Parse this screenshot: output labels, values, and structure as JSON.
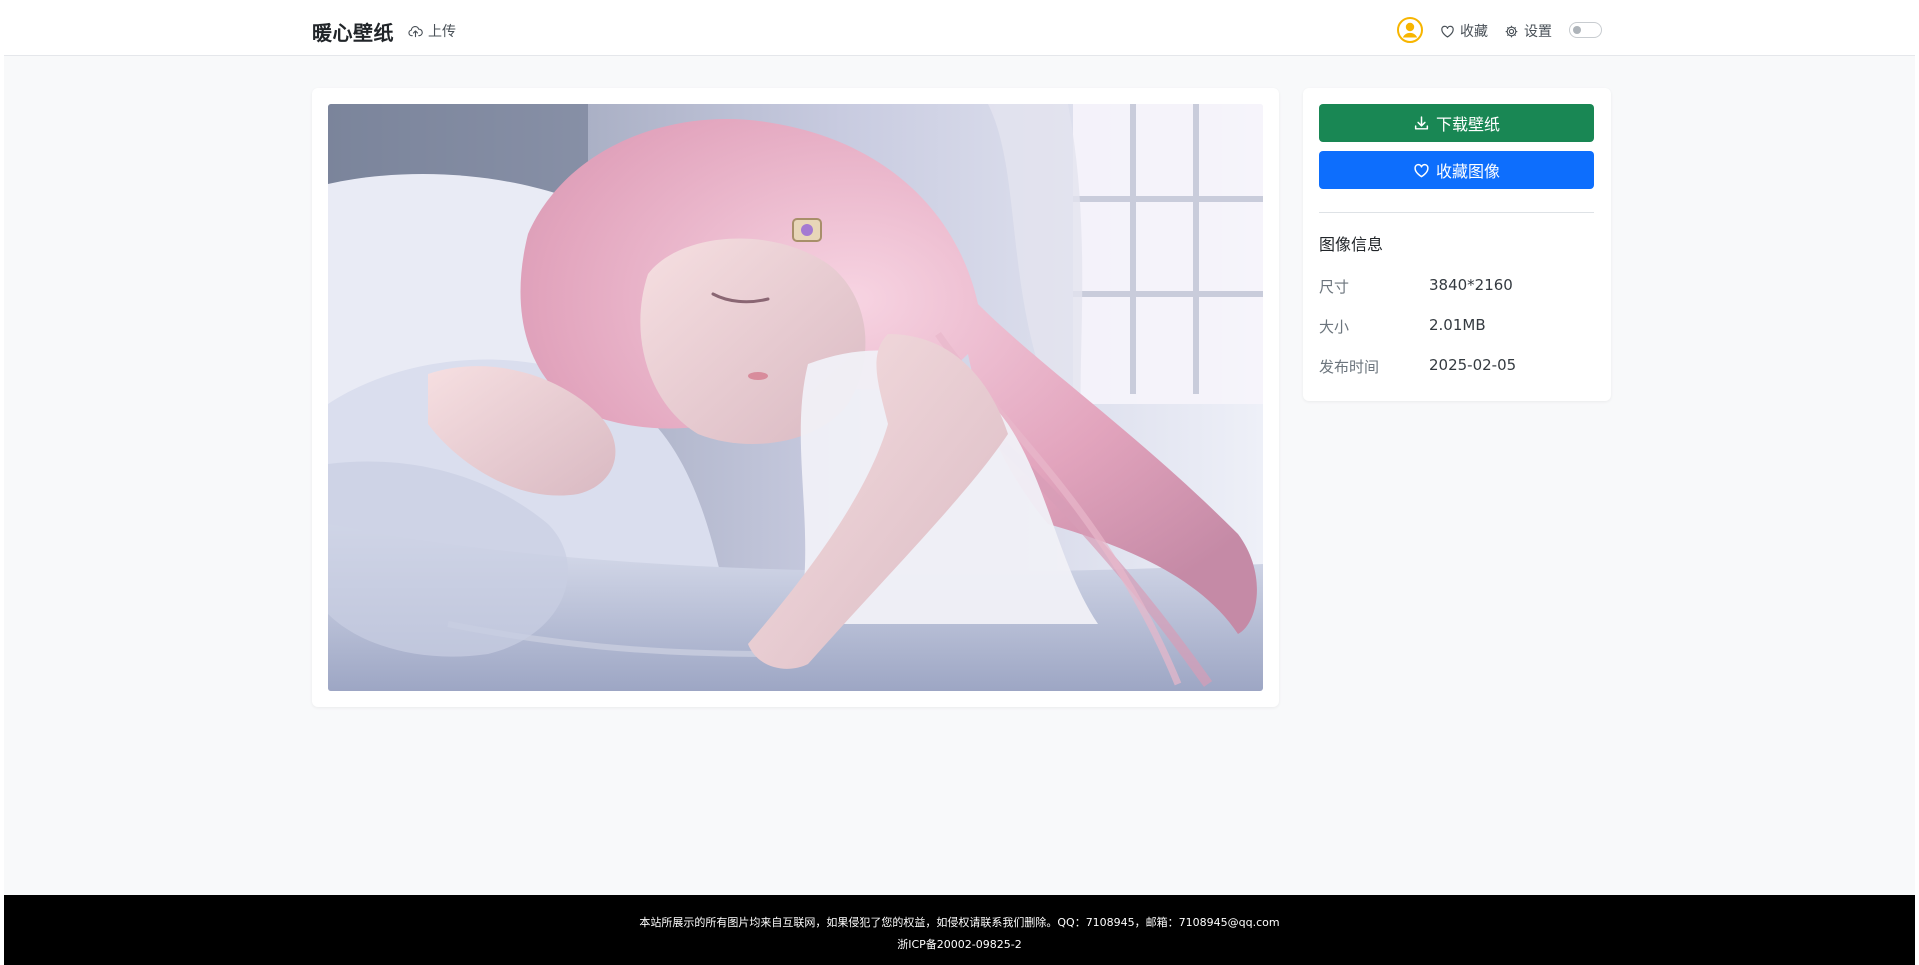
{
  "colors": {
    "download_button": "#198754",
    "favorite_button": "#0d6efd",
    "avatar": "#f7b500",
    "footer_bg": "#000000"
  },
  "navbar": {
    "brand": "暖心壁纸",
    "upload_label": "上传",
    "upload_icon": "cloud-upload-icon",
    "avatar_icon": "user-circle-icon",
    "favorites_label": "收藏",
    "favorites_icon": "heart-icon",
    "settings_label": "设置",
    "settings_icon": "gear-icon",
    "theme_toggle": "off"
  },
  "wallpaper": {
    "subject": "pink-haired anime girl sleeping on white pillows by a sunlit window"
  },
  "actions": {
    "download_label": "下载壁纸",
    "download_icon": "download-icon",
    "favorite_label": "收藏图像",
    "favorite_icon": "heart-icon"
  },
  "info": {
    "title": "图像信息",
    "rows": [
      {
        "label": "尺寸",
        "value": "3840*2160"
      },
      {
        "label": "大小",
        "value": "2.01MB"
      },
      {
        "label": "发布时间",
        "value": "2025-02-05"
      }
    ]
  },
  "footer": {
    "disclaimer": "本站所展示的所有图片均来自互联网，如果侵犯了您的权益，如侵权请联系我们删除。QQ：7108945，邮箱：7108945@qq.com",
    "icp": "浙ICP备20002-09825-2"
  }
}
